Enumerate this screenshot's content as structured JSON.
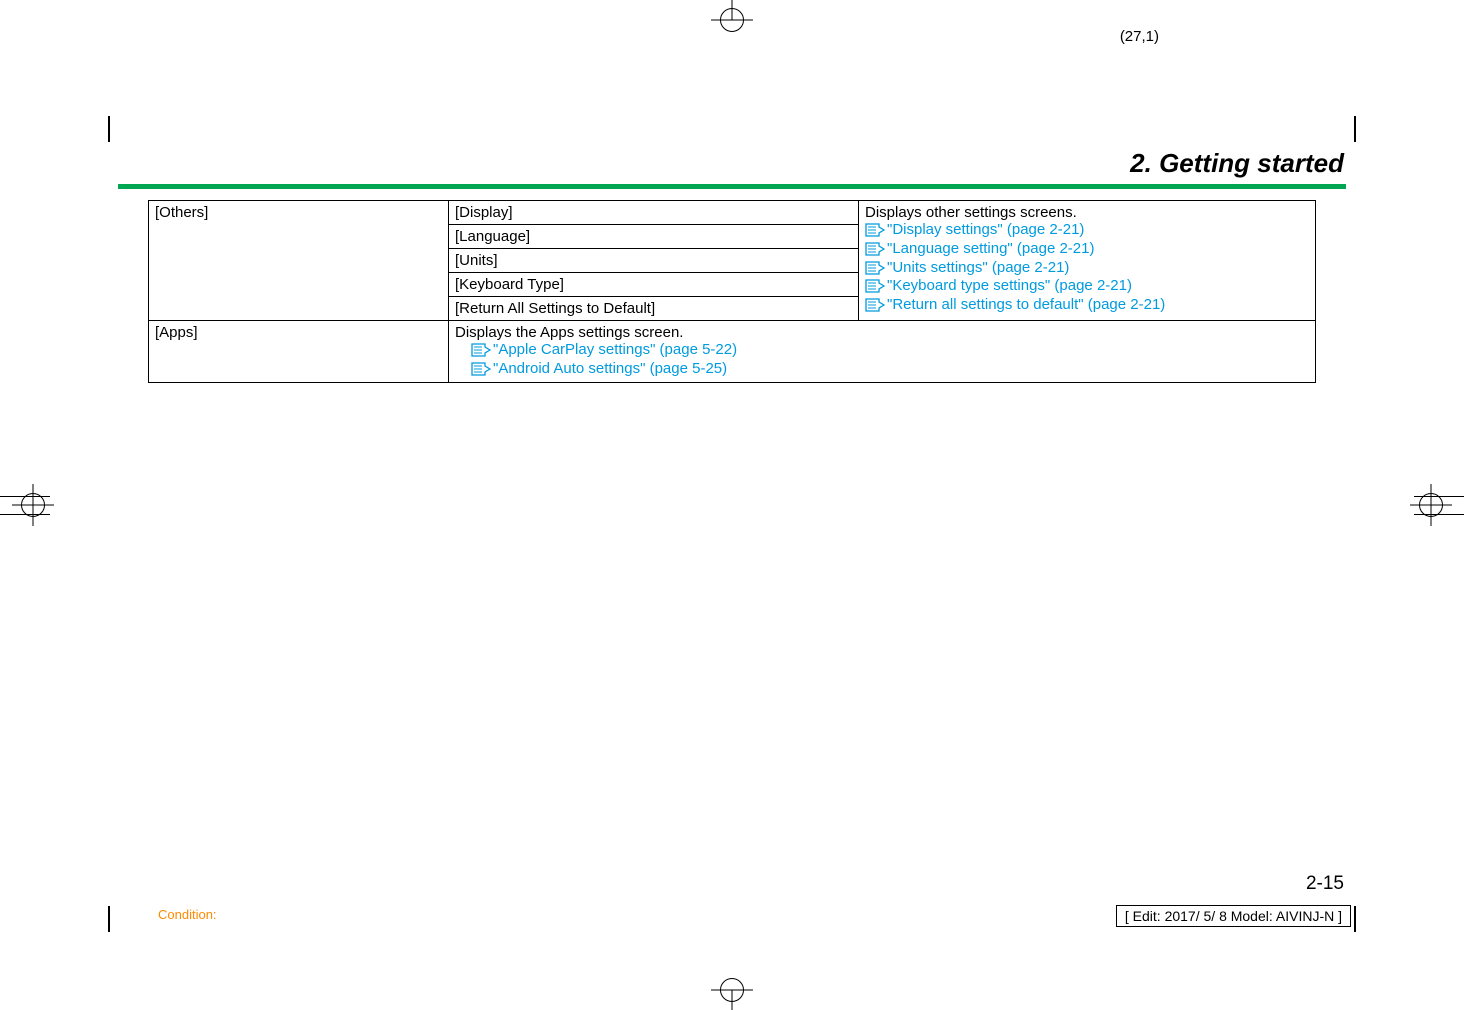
{
  "page_coord": "(27,1)",
  "chapter_title": "2. Getting started",
  "rows": {
    "others_label": "[Others]",
    "others_sub": [
      "[Display]",
      "[Language]",
      "[Units]",
      "[Keyboard Type]",
      "[Return All Settings to Default]"
    ],
    "others_desc_intro": "Displays other settings screens.",
    "others_refs": [
      "\"Display settings\" (page 2-21)",
      "\"Language setting\" (page 2-21)",
      "\"Units settings\" (page 2-21)",
      "\"Keyboard type settings\" (page 2-21)",
      "\"Return all settings to default\" (page 2-21)"
    ],
    "apps_label": "[Apps]",
    "apps_desc_intro": "Displays the Apps settings screen.",
    "apps_refs": [
      "\"Apple CarPlay settings\" (page 5-22)",
      "\"Android Auto settings\" (page 5-25)"
    ]
  },
  "page_number": "2-15",
  "condition_label": "Condition:",
  "edit_info": "[ Edit: 2017/ 5/ 8   Model: AIVINJ-N ]"
}
